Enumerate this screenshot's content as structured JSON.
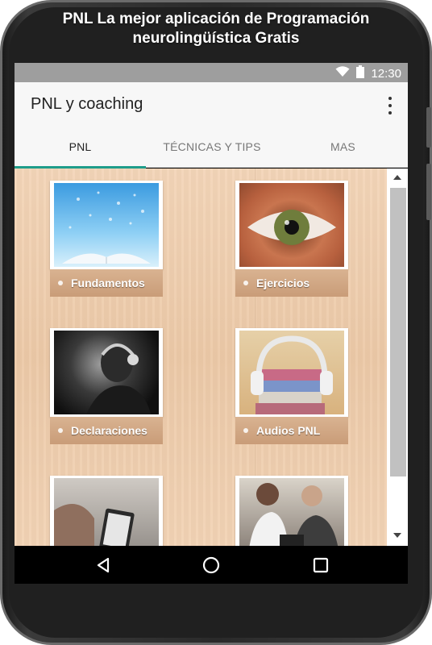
{
  "promo": {
    "title_line1": "PNL La mejor aplicación de Programación",
    "title_line2": "neurolingüística Gratis"
  },
  "status_bar": {
    "time": "12:30",
    "icons": [
      "wifi-icon",
      "battery-icon"
    ]
  },
  "app_bar": {
    "title": "PNL y coaching",
    "menu_icon": "overflow-menu-icon"
  },
  "tabs": [
    {
      "label": "PNL",
      "active": true
    },
    {
      "label": "TÉCNICAS Y TIPS",
      "active": false
    },
    {
      "label": "MAS",
      "active": false
    }
  ],
  "grid": {
    "items": [
      {
        "label": "Fundamentos",
        "image": "open-book-image"
      },
      {
        "label": "Ejercicios",
        "image": "eye-image"
      },
      {
        "label": "Declaraciones",
        "image": "man-headphones-image"
      },
      {
        "label": "Audios PNL",
        "image": "books-headphones-image"
      },
      {
        "label": "",
        "image": "person-reading-tablet-image"
      },
      {
        "label": "",
        "image": "people-meeting-image"
      }
    ]
  },
  "colors": {
    "tab_indicator": "#1e9d8b",
    "status_bar": "#9e9e9e",
    "app_bar": "#f7f7f7",
    "label_background": "#c99c78",
    "wood_background": "#ecc9a7"
  },
  "nav_bar": {
    "buttons": [
      "back-icon",
      "home-icon",
      "recents-icon"
    ]
  }
}
